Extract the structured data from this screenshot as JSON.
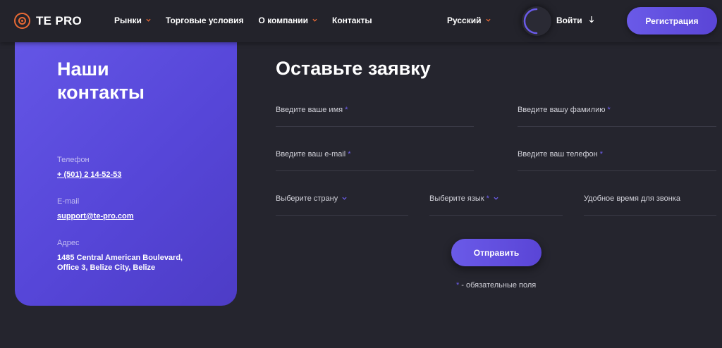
{
  "header": {
    "logo_text": "TE PRO",
    "nav": [
      {
        "label": "Рынки",
        "has_dropdown": true
      },
      {
        "label": "Торговые условия",
        "has_dropdown": false
      },
      {
        "label": "О компании",
        "has_dropdown": true
      },
      {
        "label": "Контакты",
        "has_dropdown": false
      }
    ],
    "language": "Русский",
    "login_label": "Войти",
    "register_label": "Регистрация"
  },
  "contacts": {
    "title": "Наши контакты",
    "phone_label": "Телефон",
    "phone_value": "+ (501) 2 14-52-53",
    "email_label": "E-mail",
    "email_value": "support@te-pro.com",
    "address_label": "Адрес",
    "address_value": "1485 Central American Boulevard, Office 3, Belize City, Belize"
  },
  "form": {
    "title": "Оставьте заявку",
    "first_name_label": "Введите ваше имя",
    "last_name_label": "Введите вашу фамилию",
    "email_label": "Введите ваш e-mail",
    "phone_label": "Введите ваш телефон",
    "country_label": "Выберите страну",
    "language_label": "Выберите язык",
    "call_time_label": "Удобное время для звонка",
    "required_mark": "*",
    "submit_label": "Отправить",
    "required_note": "- обязательные поля"
  },
  "colors": {
    "accent_purple": "#6456e6",
    "accent_orange": "#e86a35",
    "background": "#25252e"
  },
  "icons": [
    "logo-icon",
    "chevron-down-icon",
    "arrow-down-icon",
    "loading-spinner-icon"
  ]
}
